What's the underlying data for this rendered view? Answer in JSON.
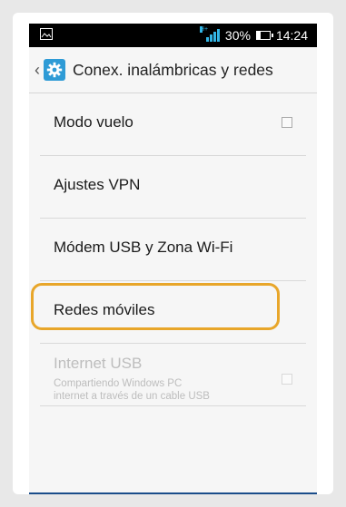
{
  "status_bar": {
    "left_icon": "image-notification-icon",
    "network_type": "H+",
    "battery_percent": "30%",
    "time": "14:24",
    "accent_color": "#33b5e5"
  },
  "action_bar": {
    "back_icon": "chevron-left-icon",
    "app_icon": "settings-gear-icon",
    "title": "Conex. inalámbricas y redes"
  },
  "settings": {
    "items": [
      {
        "label": "Modo vuelo",
        "checked": false
      },
      {
        "label": "Ajustes VPN"
      },
      {
        "label": "Módem USB y Zona Wi-Fi"
      },
      {
        "label": "Redes móviles",
        "highlighted": true,
        "highlight_color": "#e8a62a"
      },
      {
        "label": "Internet USB",
        "summary": "Compartiendo Windows PC internet a través de un cable USB",
        "summary_line1": "Compartiendo Windows PC",
        "summary_line2": "internet a través de un cable USB",
        "checked": false,
        "enabled": false
      }
    ]
  }
}
